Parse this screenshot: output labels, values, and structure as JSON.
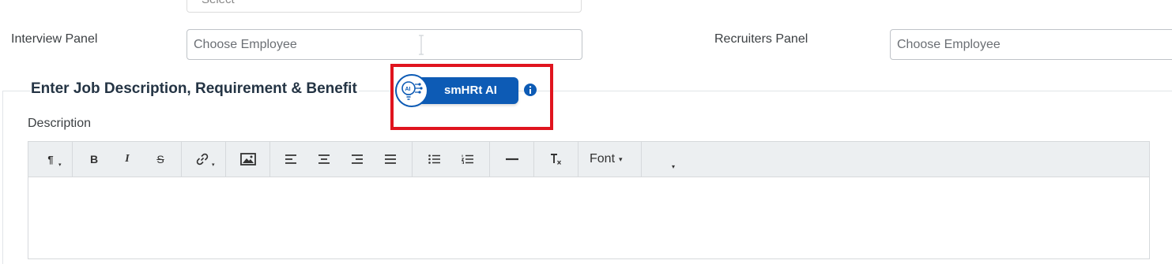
{
  "top_select": {
    "value": "Select"
  },
  "interview_panel": {
    "label": "Interview Panel",
    "placeholder": "Choose Employee"
  },
  "recruiters_panel": {
    "label": "Recruiters Panel",
    "placeholder": "Choose Employee"
  },
  "section": {
    "title": "Enter Job Description, Requirement & Benefit"
  },
  "ai_button": {
    "label": "smHRt AI",
    "icon_text": "AI"
  },
  "description": {
    "label": "Description"
  },
  "toolbar": {
    "paragraph_icon": "¶",
    "bold": "B",
    "italic": "I",
    "strike": "S",
    "font_label": "Font",
    "caret": "▾"
  },
  "colors": {
    "accent": "#0d5bb5",
    "highlight": "#e0141e",
    "title": "#243444"
  }
}
